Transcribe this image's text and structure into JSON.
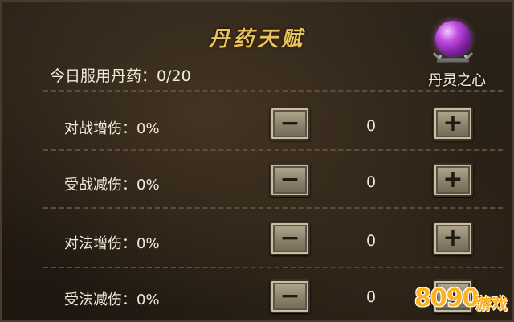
{
  "title": "丹药天赋",
  "today_label": "今日服用丹药：0/20",
  "orb": {
    "label": "丹灵之心",
    "icon": "purple-orb-icon"
  },
  "rows": [
    {
      "label": "对战增伤：0%",
      "value": "0",
      "minus": "−",
      "plus": "+"
    },
    {
      "label": "受战减伤：0%",
      "value": "0",
      "minus": "−",
      "plus": "+"
    },
    {
      "label": "对法增伤：0%",
      "value": "0",
      "minus": "−",
      "plus": "+"
    },
    {
      "label": "受法减伤：0%",
      "value": "0",
      "minus": "−",
      "plus": "+"
    }
  ],
  "watermark": {
    "number": "8090",
    "text": "游戏"
  },
  "colors": {
    "title": "#e8c25c",
    "text": "#f2ead8",
    "button": "#9c907a",
    "orb": "#b040d8",
    "watermark": "#ffb21e"
  }
}
